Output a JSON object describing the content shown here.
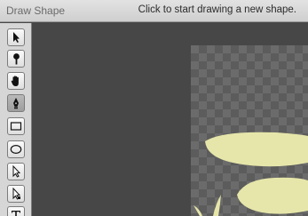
{
  "window": {
    "title": "Draw Shape",
    "status": "Click to start drawing a new shape."
  },
  "toolbar": {
    "tools": [
      {
        "name": "select-arrow-icon",
        "active": false
      },
      {
        "name": "zoom-icon",
        "active": false
      },
      {
        "name": "hand-icon",
        "active": false
      },
      {
        "name": "pen-icon",
        "active": true
      },
      {
        "name": "rectangle-icon",
        "active": false
      },
      {
        "name": "ellipse-icon",
        "active": false
      },
      {
        "name": "arrow-icon",
        "active": false
      },
      {
        "name": "subselect-arrow-icon",
        "active": false
      },
      {
        "name": "text-icon",
        "active": false
      }
    ]
  },
  "colors": {
    "shape_fill": "#e6e6aa",
    "workspace": "#474747",
    "active_tool": "#a8a8a8"
  }
}
